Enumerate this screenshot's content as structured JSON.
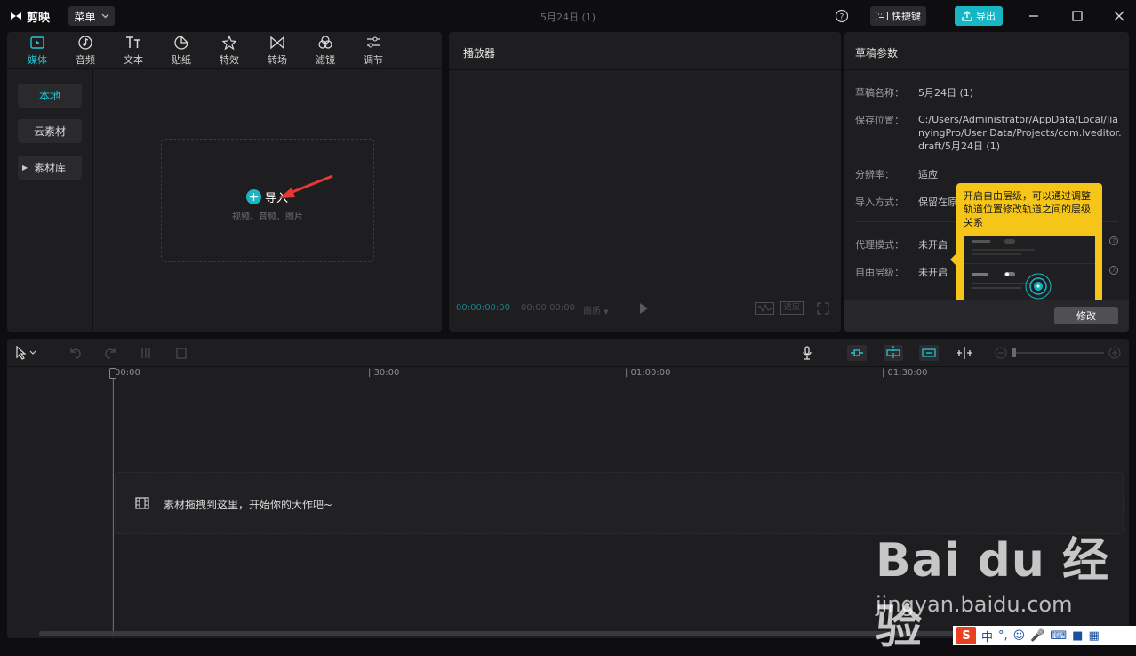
{
  "app": {
    "name": "剪映",
    "menu_label": "菜单",
    "doc_title": "5月24日 (1)",
    "shortcut_label": "快捷键",
    "export_label": "导出"
  },
  "media": {
    "tabs": [
      {
        "label": "媒体",
        "icon": "media-icon"
      },
      {
        "label": "音频",
        "icon": "audio-icon"
      },
      {
        "label": "文本",
        "icon": "text-icon"
      },
      {
        "label": "贴纸",
        "icon": "sticker-icon"
      },
      {
        "label": "特效",
        "icon": "effects-icon"
      },
      {
        "label": "转场",
        "icon": "transition-icon"
      },
      {
        "label": "滤镜",
        "icon": "filter-icon"
      },
      {
        "label": "调节",
        "icon": "adjust-icon"
      }
    ],
    "side": [
      "本地",
      "云素材",
      "素材库"
    ],
    "import_label": "导入",
    "import_hint": "视频、音频、图片"
  },
  "player": {
    "title": "播放器",
    "timecode_current": "00:00:00:00",
    "timecode_total": "00:00:00:00",
    "ratio_label": "画质",
    "fit_label": "适应"
  },
  "draft": {
    "title": "草稿参数",
    "rows": [
      {
        "label": "草稿名称：",
        "value": "5月24日 (1)"
      },
      {
        "label": "保存位置：",
        "value_lines": [
          "C:/Users/Administrator/AppData/Local/Jia",
          "nyingPro/User Data/Projects/com.lveditor.",
          "draft/5月24日 (1)"
        ]
      },
      {
        "label": "分辨率：",
        "value": "适应"
      },
      {
        "label": "导入方式：",
        "value": "保留在原"
      },
      {
        "label": "代理模式：",
        "value": "未开启"
      },
      {
        "label": "自由层级：",
        "value": "未开启"
      }
    ],
    "modify_label": "修改",
    "tooltip": "开启自由层级，可以通过调整轨道位置修改轨道之间的层级关系"
  },
  "timeline": {
    "ticks": [
      "00:00",
      "| 30:00",
      "| 01:00:00",
      "| 01:30:00"
    ],
    "drop_hint": "素材拖拽到这里，开始你的大作吧~"
  },
  "watermark": {
    "brand": "Bai du 经验",
    "url": "jingyan.baidu.com"
  },
  "ime": {
    "label": "中"
  },
  "colors": {
    "accent": "#18b6c4",
    "tooltip": "#f5c518",
    "arrow": "#e53935"
  }
}
